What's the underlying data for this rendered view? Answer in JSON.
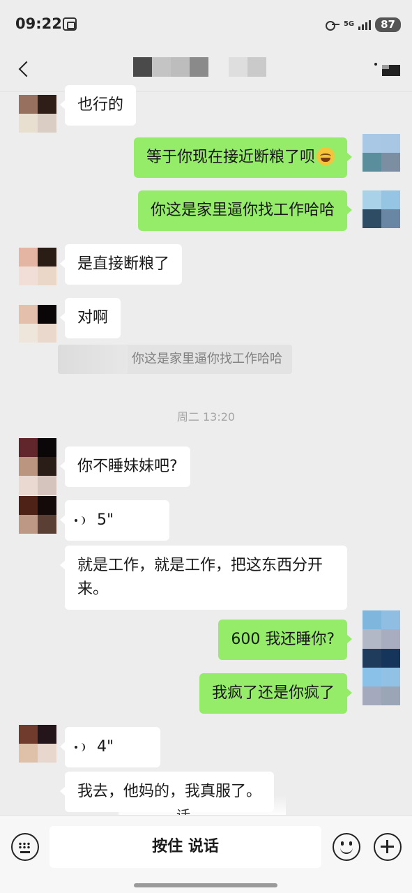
{
  "status_bar": {
    "time": "09:22",
    "network": "5G",
    "battery": "87"
  },
  "nav": {
    "title": ""
  },
  "messages": [
    {
      "sender": "other",
      "type": "text",
      "text": "也行的"
    },
    {
      "sender": "me",
      "type": "text",
      "text": "等于你现在接近断粮了呗",
      "emoji": "laughing-crying-emoji"
    },
    {
      "sender": "me",
      "type": "text",
      "text": "你这是家里逼你找工作哈哈"
    },
    {
      "sender": "other",
      "type": "text",
      "text": "是直接断粮了"
    },
    {
      "sender": "other",
      "type": "text",
      "text": "对啊",
      "quote": "你这是家里逼你找工作哈哈"
    },
    {
      "type": "timestamp",
      "text": "周二 13:20"
    },
    {
      "sender": "other",
      "type": "text",
      "text": "你不睡妹妹吧?"
    },
    {
      "sender": "other",
      "type": "voice",
      "duration": "5\""
    },
    {
      "sender": "other",
      "type": "text",
      "text": "就是工作，就是工作，把这东西分开来。"
    },
    {
      "sender": "me",
      "type": "text",
      "text": "600 我还睡你?"
    },
    {
      "sender": "me",
      "type": "text",
      "text": "我疯了还是你疯了"
    },
    {
      "sender": "other",
      "type": "voice",
      "duration": "4\""
    },
    {
      "sender": "other",
      "type": "text",
      "text": "我去，他妈的，我真服了。"
    }
  ],
  "overlay_text": "话",
  "input_bar": {
    "hold_to_talk_label": "按住 说话"
  },
  "colors": {
    "background": "#ededed",
    "outgoing_bubble": "#95ec69",
    "incoming_bubble": "#ffffff"
  }
}
